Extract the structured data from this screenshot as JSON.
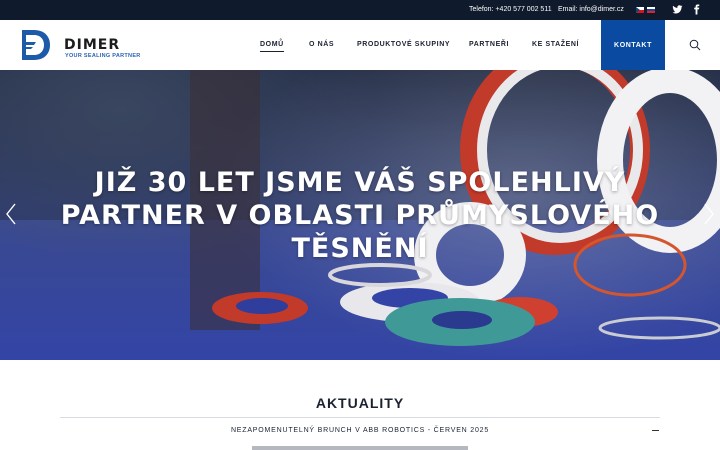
{
  "topbar": {
    "phone": "Telefon: +420 577 002 511",
    "email": "Email: info@dimer.cz",
    "languages": [
      "cz-flag-icon",
      "sk-flag-icon"
    ],
    "social": [
      "twitter-icon",
      "facebook-icon"
    ]
  },
  "brand": {
    "name": "DIMER",
    "tagline": "YOUR SEALING PARTNER",
    "color": "#1d5ba9"
  },
  "nav": {
    "items": [
      {
        "label": "DOMŮ",
        "active": true
      },
      {
        "label": "O NÁS"
      },
      {
        "label": "PRODUKTOVÉ SKUPINY"
      },
      {
        "label": "PARTNEŘI"
      },
      {
        "label": "KE STAŽENÍ"
      }
    ],
    "contact": "KONTAKT",
    "contact_color": "#0a4aa0"
  },
  "hero": {
    "title": "JIŽ 30 LET JSME VÁŠ SPOLEHLIVÝ PARTNER V OBLASTI PRŮMYSLOVÉHO TĚSNĚNÍ"
  },
  "news": {
    "title": "AKTUALITY",
    "items": [
      {
        "title": "NEZAPOMENUTELNÝ BRUNCH V ABB ROBOTICS - ČERVEN 2025"
      }
    ]
  }
}
